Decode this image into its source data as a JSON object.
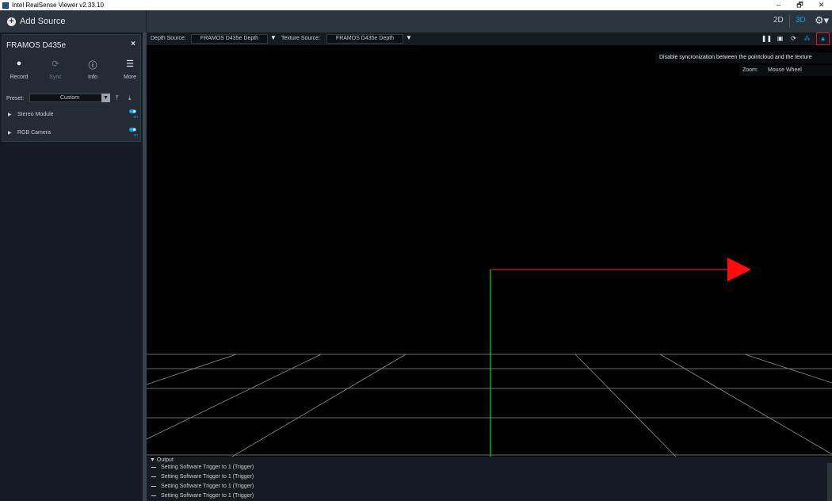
{
  "window": {
    "title": "Intel RealSense Viewer v2.33.10",
    "controls": [
      "–",
      "🗗",
      "✕"
    ]
  },
  "topbar": {
    "add_source_label": "Add Source",
    "view_2d": "2D",
    "view_3d": "3D",
    "settings_icon": "gear-icon"
  },
  "device": {
    "name": "FRAMOS D435e",
    "close": "×",
    "buttons": [
      {
        "label": "Record",
        "icon": "record-icon"
      },
      {
        "label": "Sync",
        "icon": "sync-icon"
      },
      {
        "label": "Info",
        "icon": "info-icon"
      },
      {
        "label": "More",
        "icon": "menu-icon"
      }
    ],
    "preset_label": "Preset:",
    "preset_value": "Custom",
    "modules": [
      {
        "name": "Stereo Module",
        "toggle": "on"
      },
      {
        "name": "RGB Camera",
        "toggle": "on"
      }
    ]
  },
  "viewport": {
    "depth_source_label": "Depth Source:",
    "depth_source_value": "FRAMOS D435e Depth",
    "texture_source_label": "Texture Source:",
    "texture_source_value": "FRAMOS D435e Depth",
    "tooltip": "Disable syncronization between the pointcloud and the texture",
    "zoom_key": "Zoom:",
    "zoom_value": "Mouse Wheel",
    "axis_colors": {
      "x": "#e01818",
      "y": "#20d020",
      "grid": "#8a8f94"
    }
  },
  "output": {
    "header": "Output",
    "lines": [
      "Setting Software Trigger to 1 (Trigger)",
      "Setting Software Trigger to 1 (Trigger)",
      "Setting Software Trigger to 1 (Trigger)",
      "Setting Software Trigger to 1 (Trigger)"
    ]
  }
}
